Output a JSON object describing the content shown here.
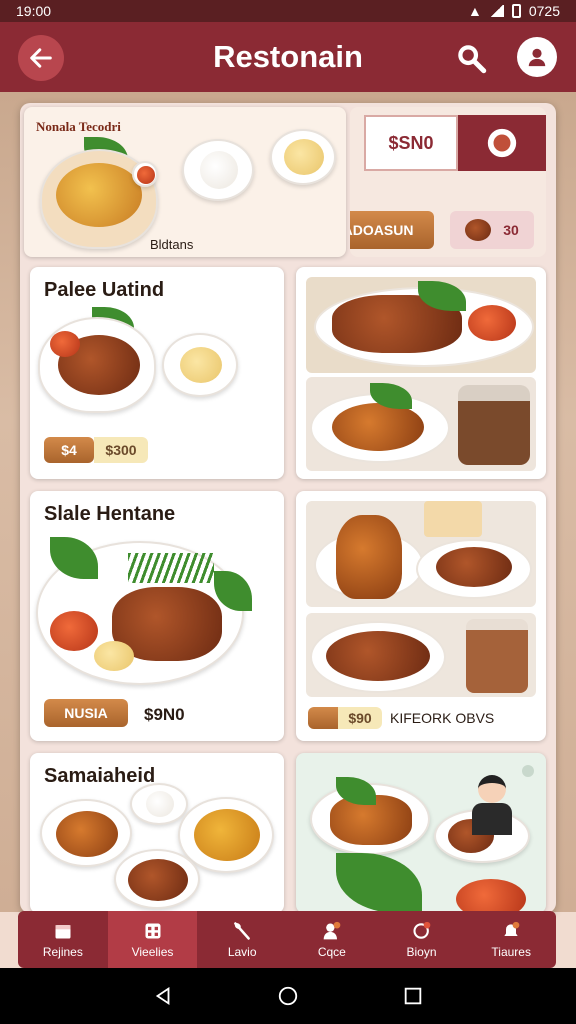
{
  "status": {
    "time": "19:00",
    "right_text": "0725"
  },
  "app_bar": {
    "title": "Restonain"
  },
  "hero": {
    "banner_title": "Nonala Tecodri",
    "caption": "Bldtans",
    "price_label": "$SN0",
    "action_button": "KADOASUN",
    "small_price": "30"
  },
  "cards": [
    {
      "title": "Palee Uatind",
      "badge": "$4",
      "price": "$300"
    },
    {
      "title": "Slale Hentane",
      "badge": "NUSIA",
      "price": "$9N0"
    },
    {
      "title": "Samaiaheid"
    }
  ],
  "right_card_2": {
    "badge": "$90",
    "label": "KIFEORK OBVS"
  },
  "bottom_nav": [
    {
      "label": "Rejines",
      "icon": "calendar-icon"
    },
    {
      "label": "Vieelies",
      "icon": "grid-icon"
    },
    {
      "label": "Lavio",
      "icon": "utensils-icon"
    },
    {
      "label": "Cqce",
      "icon": "chef-icon"
    },
    {
      "label": "Bioyn",
      "icon": "location-icon"
    },
    {
      "label": "Tiaures",
      "icon": "bell-icon"
    }
  ],
  "colors": {
    "primary": "#8b2a34",
    "accent": "#b23c46",
    "panel": "#f3e2dc"
  }
}
